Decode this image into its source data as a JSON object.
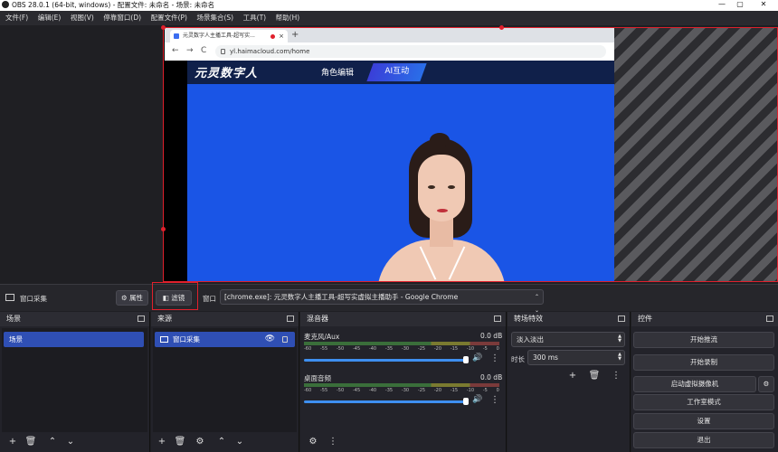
{
  "window": {
    "title": "OBS 28.0.1 (64-bit, windows) - 配置文件: 未命名 - 场景: 未命名",
    "min": "—",
    "max": "▢",
    "close": "✕"
  },
  "menu": [
    "文件(F)",
    "编辑(E)",
    "视图(V)",
    "停靠窗口(D)",
    "配置文件(P)",
    "场景集合(S)",
    "工具(T)",
    "帮助(H)"
  ],
  "browser": {
    "tab_title": "元灵数字人主播工具-超写实...",
    "tab_close": "×",
    "new_tab": "+",
    "back": "←",
    "forward": "→",
    "reload": "C",
    "url": "yl.haimacloud.com/home"
  },
  "site": {
    "logo": "元灵数字人",
    "tabs": [
      "角色编辑",
      "AI互动"
    ]
  },
  "source_toolbar": {
    "source_name": "窗口采集",
    "properties_label": "属性",
    "filters_label": "滤镜",
    "window_label": "窗口",
    "window_value": "[chrome.exe]: 元灵数字人主播工具-超写实虚拟主播助手 - Google Chrome"
  },
  "docks": {
    "scenes": {
      "title": "场景",
      "items": [
        "场景"
      ]
    },
    "sources": {
      "title": "来源",
      "items": [
        "窗口采集"
      ]
    },
    "mixer": {
      "title": "混音器",
      "channels": [
        {
          "name": "麦克风/Aux",
          "db": "0.0 dB",
          "volume": 1.0
        },
        {
          "name": "桌面音频",
          "db": "0.0 dB",
          "volume": 1.0
        }
      ],
      "scale": [
        "-60",
        "-55",
        "-50",
        "-45",
        "-40",
        "-35",
        "-30",
        "-25",
        "-20",
        "-15",
        "-10",
        "-5",
        "0"
      ]
    },
    "transitions": {
      "title": "转场特效",
      "type": "淡入淡出",
      "duration_label": "时长",
      "duration_value": "300 ms"
    },
    "controls": {
      "title": "控件",
      "buttons": [
        "开始推流",
        "开始录制",
        "启动虚拟摄像机",
        "工作室模式",
        "设置",
        "退出"
      ]
    }
  },
  "icons": {
    "plus": "+",
    "trash": "🗑",
    "up": "⌃",
    "down": "⌄",
    "gear": "⚙",
    "dots": "⋮",
    "speaker": "🔊",
    "eye": "👁"
  },
  "colors": {
    "accent": "#2f4fb4",
    "selection_red": "#e0202c",
    "site_blue": "#1a55e6"
  }
}
